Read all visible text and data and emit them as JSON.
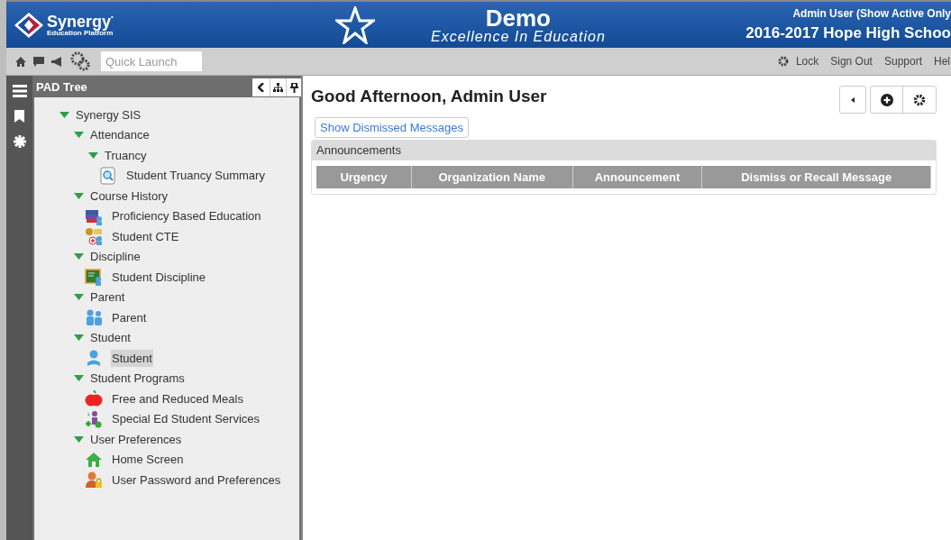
{
  "header": {
    "logo_name": "Synergy",
    "logo_mark": "•",
    "logo_sub": "Education Platform",
    "title": "Demo",
    "subtitle": "Excellence In Education",
    "user": "Admin User (Show Active Only",
    "school": "2016-2017 Hope High Schoo"
  },
  "toolbar": {
    "search": {
      "placeholder": "Quick Launch"
    },
    "links": [
      "Lock",
      "Sign Out",
      "Support",
      "Hel"
    ]
  },
  "pad_tree": {
    "title": "PAD Tree",
    "items": [
      {
        "label": "Synergy SIS",
        "expanded": true,
        "selected": false,
        "children": [
          {
            "label": "Attendance",
            "expanded": true,
            "selected": false,
            "children": [
              {
                "label": "Truancy",
                "expanded": true,
                "selected": false,
                "children": [
                  {
                    "label": "Student Truancy Summary",
                    "selected": false
                  }
                ]
              }
            ]
          },
          {
            "label": "Course History",
            "expanded": true,
            "selected": false,
            "children": [
              {
                "label": "Proficiency Based Education",
                "selected": false
              },
              {
                "label": "Student CTE",
                "selected": false
              }
            ]
          },
          {
            "label": "Discipline",
            "expanded": true,
            "selected": false,
            "children": [
              {
                "label": "Student Discipline",
                "selected": false
              }
            ]
          },
          {
            "label": "Parent",
            "expanded": true,
            "selected": false,
            "children": [
              {
                "label": "Parent",
                "selected": false
              }
            ]
          },
          {
            "label": "Student",
            "expanded": true,
            "selected": false,
            "children": [
              {
                "label": "Student",
                "selected": true
              }
            ]
          },
          {
            "label": "Student Programs",
            "expanded": true,
            "selected": false,
            "children": [
              {
                "label": "Free and Reduced Meals",
                "selected": false
              },
              {
                "label": "Special Ed Student Services",
                "selected": false
              }
            ]
          },
          {
            "label": "User Preferences",
            "expanded": true,
            "selected": false,
            "children": [
              {
                "label": "Home Screen",
                "selected": false
              },
              {
                "label": "User Password and Preferences",
                "selected": false
              }
            ]
          }
        ]
      }
    ]
  },
  "main": {
    "greeting": "Good Afternoon, Admin User",
    "dismissed_button": "Show Dismissed Messages",
    "announcements": {
      "title": "Announcements",
      "columns": [
        "Urgency",
        "Organization Name",
        "Announcement",
        "Dismiss or Recall Message"
      ]
    }
  }
}
